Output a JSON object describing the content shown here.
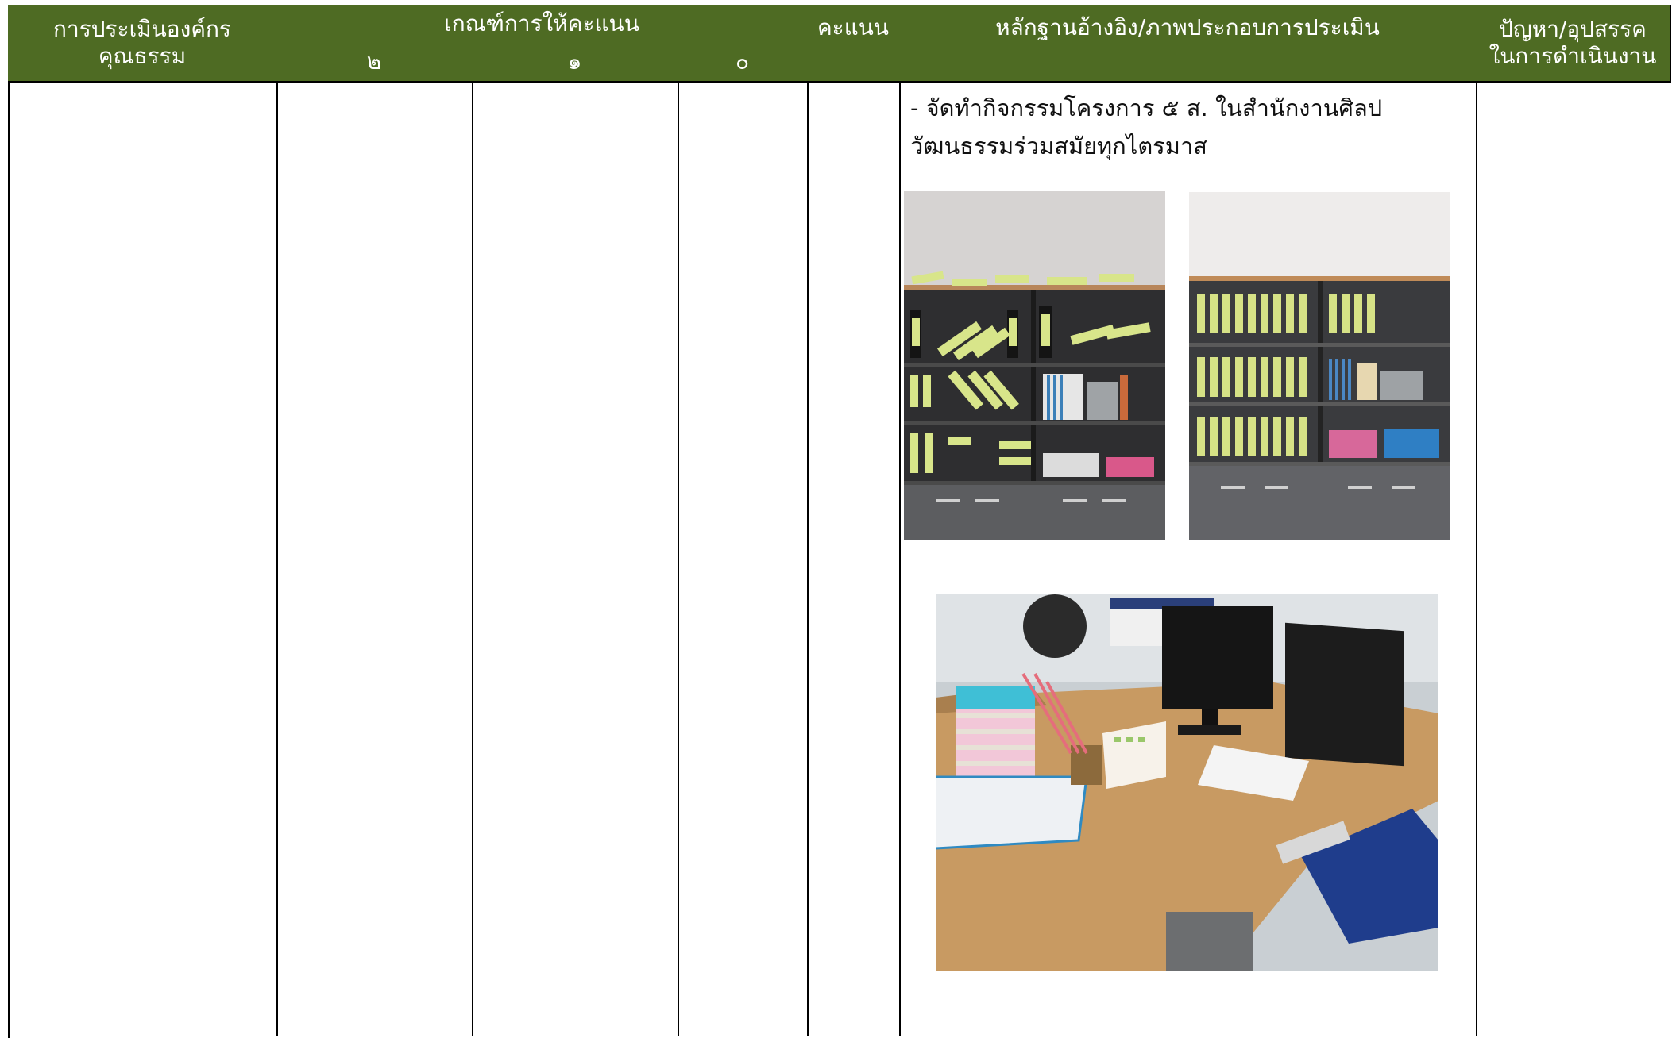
{
  "header": {
    "col_org": "การประเมินองค์กร\nคุณธรรม",
    "col_criteria": "เกณฑ์การให้คะแนน",
    "col_score": "คะแนน",
    "col_evidence": "หลักฐานอ้างอิง/ภาพประกอบการประเมิน",
    "col_problems": "ปัญหา/อุปสรรค\nในการดำเนินงาน",
    "sub_2": "๒",
    "sub_1": "๑",
    "sub_0": "๐"
  },
  "evidence": {
    "text": "- จัดทำกิจกรรมโครงการ ๕ ส. ในสำนักงานศิลปวัฒนธรรมร่วมสมัยทุกไตรมาส"
  },
  "colors": {
    "header_bg": "#4e6b23",
    "header_text": "#ffffff",
    "border": "#000000"
  }
}
